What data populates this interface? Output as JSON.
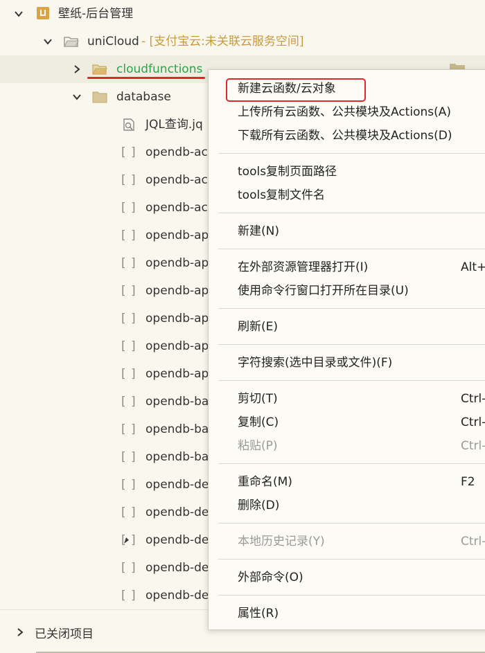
{
  "tree": {
    "project": {
      "label": "壁纸-后台管理",
      "icon": "project-icon"
    },
    "unicloud": {
      "label": "uniCloud",
      "suffix": " - [支付宝云:未关联云服务空间]"
    },
    "cloudfunctions": {
      "label": "cloudfunctions"
    },
    "database": {
      "label": "database"
    },
    "jql": {
      "label": "JQL查询.jq"
    },
    "items": [
      {
        "label": "opendb-ac"
      },
      {
        "label": "opendb-ac"
      },
      {
        "label": "opendb-ac"
      },
      {
        "label": "opendb-ap"
      },
      {
        "label": "opendb-ap"
      },
      {
        "label": "opendb-ap"
      },
      {
        "label": "opendb-ap"
      },
      {
        "label": "opendb-ap"
      },
      {
        "label": "opendb-ap"
      },
      {
        "label": "opendb-ba"
      },
      {
        "label": "opendb-ba"
      },
      {
        "label": "opendb-ba"
      },
      {
        "label": "opendb-de"
      },
      {
        "label": "opendb-de"
      },
      {
        "label": "opendb-de"
      },
      {
        "label": "opendb-de"
      },
      {
        "label": "opendb-de"
      }
    ]
  },
  "footer": {
    "closed_projects": "已关闭项目"
  },
  "context_menu": {
    "groups": [
      [
        {
          "label": "新建云函数/云对象",
          "shortcut": "",
          "disabled": false
        },
        {
          "label": "上传所有云函数、公共模块及Actions(A)",
          "shortcut": "",
          "disabled": false
        },
        {
          "label": "下载所有云函数、公共模块及Actions(D)",
          "shortcut": "",
          "disabled": false
        }
      ],
      [
        {
          "label": "tools复制页面路径",
          "shortcut": "",
          "disabled": false
        },
        {
          "label": "tools复制文件名",
          "shortcut": "",
          "disabled": false
        }
      ],
      [
        {
          "label": "新建(N)",
          "shortcut": "",
          "disabled": false
        }
      ],
      [
        {
          "label": "在外部资源管理器打开(I)",
          "shortcut": "Alt+",
          "disabled": false
        },
        {
          "label": "使用命令行窗口打开所在目录(U)",
          "shortcut": "",
          "disabled": false
        }
      ],
      [
        {
          "label": "刷新(E)",
          "shortcut": "",
          "disabled": false
        }
      ],
      [
        {
          "label": "字符搜索(选中目录或文件)(F)",
          "shortcut": "",
          "disabled": false
        }
      ],
      [
        {
          "label": "剪切(T)",
          "shortcut": "Ctrl-",
          "disabled": false
        },
        {
          "label": "复制(C)",
          "shortcut": "Ctrl-",
          "disabled": false
        },
        {
          "label": "粘贴(P)",
          "shortcut": "Ctrl-",
          "disabled": true
        }
      ],
      [
        {
          "label": "重命名(M)",
          "shortcut": "F2",
          "disabled": false
        },
        {
          "label": "删除(D)",
          "shortcut": "",
          "disabled": false
        }
      ],
      [
        {
          "label": "本地历史记录(Y)",
          "shortcut": "Ctrl-",
          "disabled": true
        }
      ],
      [
        {
          "label": "外部命令(O)",
          "shortcut": "",
          "disabled": false
        }
      ],
      [
        {
          "label": "属性(R)",
          "shortcut": "",
          "disabled": false
        }
      ]
    ]
  },
  "colors": {
    "background": "#FAF8EE",
    "highlight_row": "#EFEDDF",
    "green_text": "#2BA24C",
    "hint_text": "#C69A3E",
    "annotation_red": "#E0262C"
  },
  "icons": {
    "expanded": "chevron-down-icon",
    "collapsed": "chevron-right-icon",
    "folder": "folder-icon",
    "file": "json-file-icon",
    "search_file": "jql-file-icon"
  }
}
